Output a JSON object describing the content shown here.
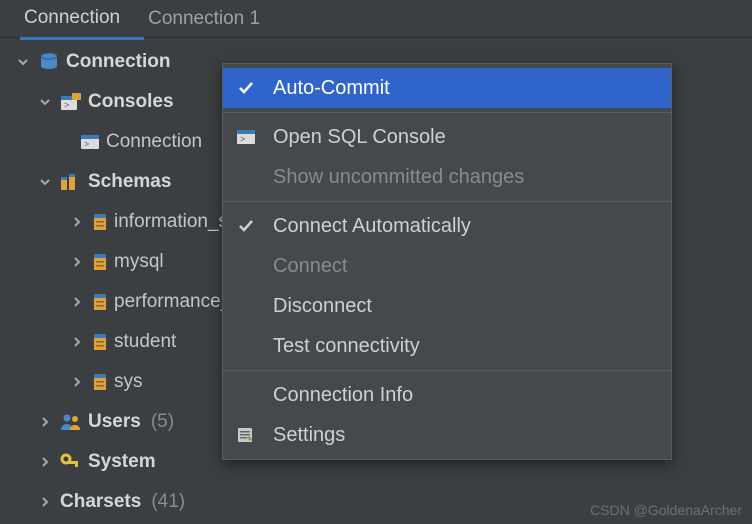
{
  "tabs": {
    "active": "Connection",
    "other": "Connection 1"
  },
  "tree": {
    "root": "Connection",
    "consoles": {
      "label": "Consoles",
      "child": "Connection"
    },
    "schemas": {
      "label": "Schemas",
      "items": [
        "information_schema",
        "mysql",
        "performance_schema",
        "student",
        "sys"
      ]
    },
    "users": {
      "label": "Users",
      "count": "(5)"
    },
    "system": {
      "label": "System"
    },
    "charsets": {
      "label": "Charsets",
      "count": "(41)"
    }
  },
  "menu": {
    "auto_commit": "Auto-Commit",
    "open_console": "Open SQL Console",
    "show_uncommitted": "Show uncommitted changes",
    "connect_auto": "Connect Automatically",
    "connect": "Connect",
    "disconnect": "Disconnect",
    "test": "Test connectivity",
    "info": "Connection Info",
    "settings": "Settings"
  },
  "watermark": "CSDN @GoldenaArcher"
}
